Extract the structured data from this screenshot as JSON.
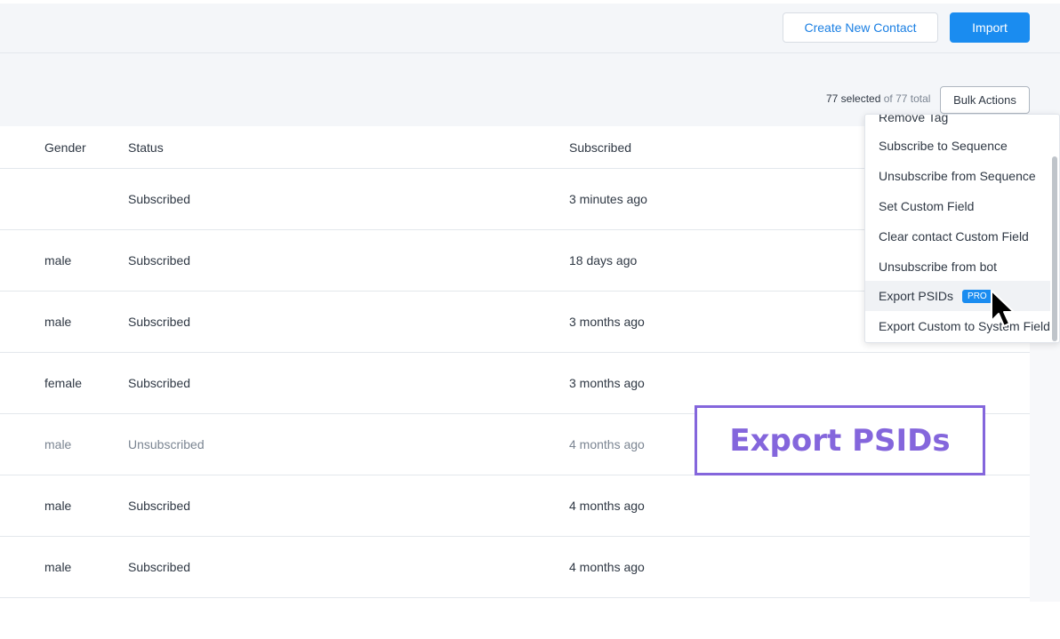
{
  "header": {
    "create_label": "Create New Contact",
    "import_label": "Import"
  },
  "selection": {
    "selected_text": "77 selected",
    "total_text": "of 77 total",
    "bulk_label": "Bulk Actions"
  },
  "table": {
    "columns": [
      "Gender",
      "Status",
      "Subscribed"
    ],
    "rows": [
      {
        "gender": "",
        "status": "Subscribed",
        "subscribed": "3 minutes ago"
      },
      {
        "gender": "male",
        "status": "Subscribed",
        "subscribed": "18 days ago"
      },
      {
        "gender": "male",
        "status": "Subscribed",
        "subscribed": "3 months ago"
      },
      {
        "gender": "female",
        "status": "Subscribed",
        "subscribed": "3 months ago"
      },
      {
        "gender": "male",
        "status": "Unsubscribed",
        "subscribed": "4 months ago"
      },
      {
        "gender": "male",
        "status": "Subscribed",
        "subscribed": "4 months ago"
      },
      {
        "gender": "male",
        "status": "Subscribed",
        "subscribed": "4 months ago"
      }
    ]
  },
  "bulk_menu": {
    "items": [
      "Remove Tag",
      "Subscribe to Sequence",
      "Unsubscribe from Sequence",
      "Set Custom Field",
      "Clear contact Custom Field",
      "Unsubscribe from bot",
      "Export PSIDs",
      "Export Custom to System Field"
    ],
    "pro_badge": "PRO"
  },
  "callout": {
    "text": "Export PSIDs"
  },
  "colors": {
    "accent": "#1a8cf0",
    "callout": "#8466dc"
  }
}
